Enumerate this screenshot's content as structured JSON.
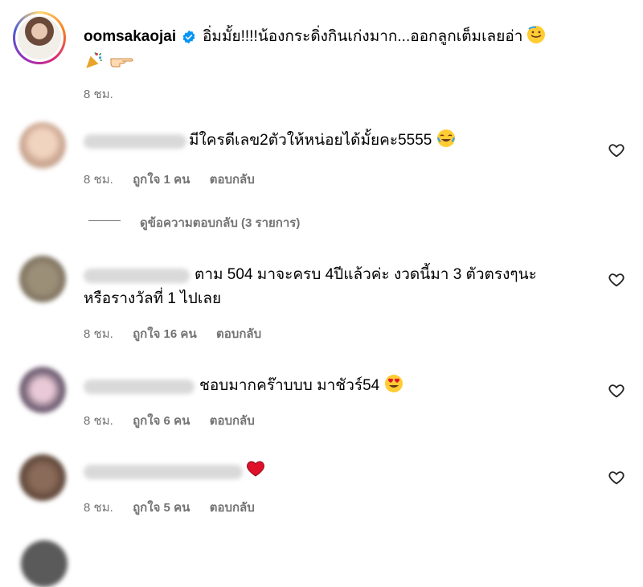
{
  "post": {
    "username": "oomsakaojai",
    "verified_icon": "verified-badge-icon",
    "caption_line1": "อิ่มมั้ย!!!!น้องกระดิ่งกินเก่งมาก...ออกลูกเต็มเลยอ่า",
    "caption_line2": "",
    "time": "8 ชม."
  },
  "labels": {
    "likes_prefix": "ถูกใจ",
    "likes_suffix": "คน",
    "reply": "ตอบกลับ",
    "view_replies": "ดูข้อความตอบกลับ (3 รายการ)"
  },
  "comments": [
    {
      "text": "มีใครดีเลข2ตัวให้หน่อยได้มั้ยคะ5555",
      "time": "8 ชม.",
      "likes": "1",
      "emoji": "tears-of-joy-emoji"
    },
    {
      "text": "ตาม 504 มาจะครบ 4ปีแล้วค่ะ งวดนี้มา 3 ตัวตรงๆนะ",
      "text2": "หรือรางวัลที่ 1 ไปเลย",
      "time": "8 ชม.",
      "likes": "16"
    },
    {
      "text": "ชอบมากคร๊าบบบ มาชัวร์54",
      "time": "8 ชม.",
      "likes": "6",
      "emoji": "heart-eyes-emoji"
    },
    {
      "text": "",
      "time": "8 ชม.",
      "likes": "5",
      "emoji": "red-heart-emoji"
    }
  ],
  "colors": {
    "text": "#000000",
    "meta": "#737373",
    "verified": "#0095f6",
    "heart_emoji": "#e0102b"
  }
}
